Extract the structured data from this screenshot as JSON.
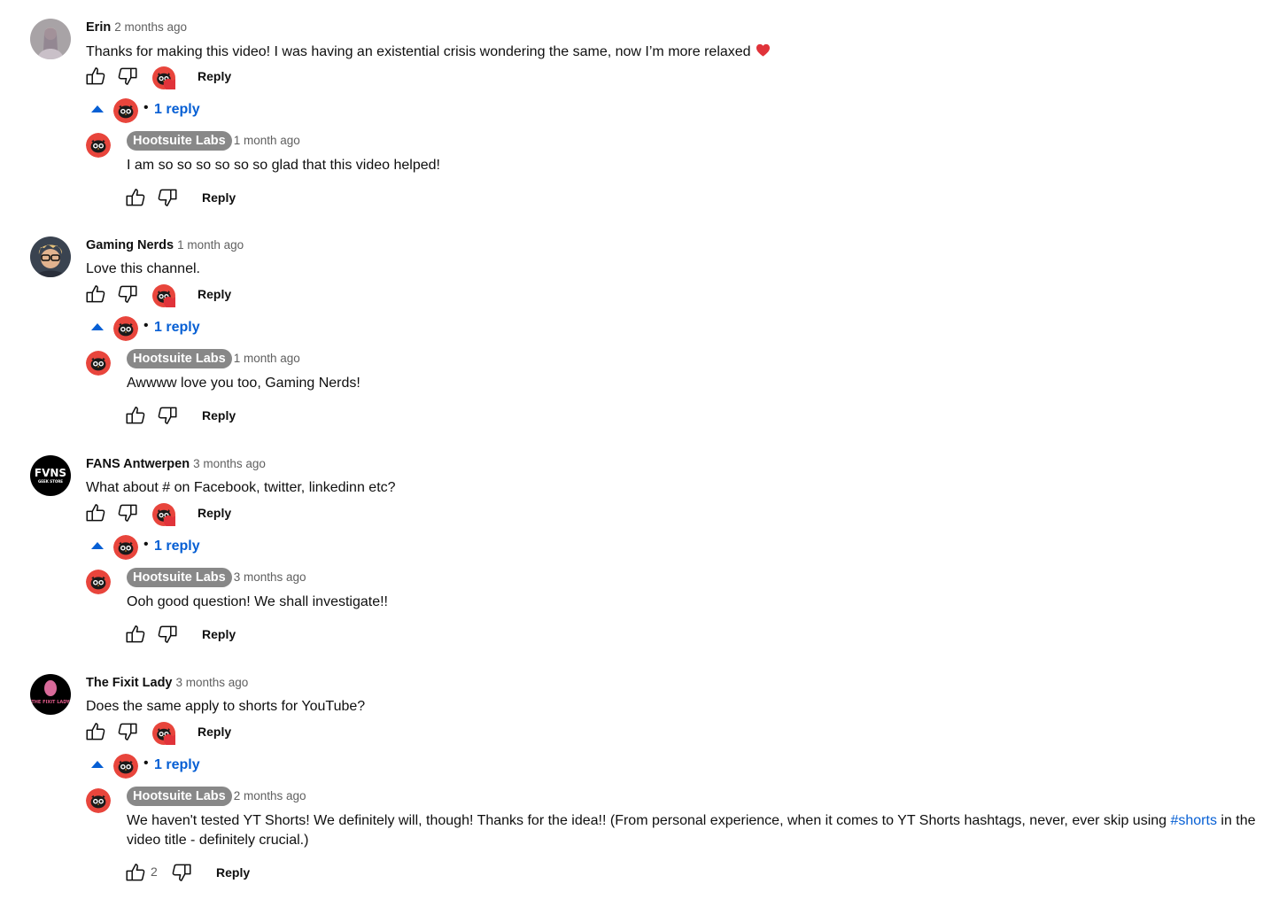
{
  "threads": [
    {
      "author": "Erin",
      "time": "2 months ago",
      "text": "Thanks for making this video! I was having an existential crisis wondering the same, now I’m more relaxed",
      "has_heart_emoji": true,
      "reply_label": "Reply",
      "reply_count": "1 reply",
      "reply": {
        "author": "Hootsuite Labs",
        "time": "1 month ago",
        "text": "I am so so so so so so glad that this video helped!",
        "reply_label": "Reply"
      }
    },
    {
      "author": "Gaming Nerds",
      "time": "1 month ago",
      "text": "Love this channel.",
      "reply_label": "Reply",
      "reply_count": "1 reply",
      "reply": {
        "author": "Hootsuite Labs",
        "time": "1 month ago",
        "text": "Awwww love you too, Gaming Nerds!",
        "reply_label": "Reply"
      }
    },
    {
      "author": "FANS Antwerpen",
      "time": "3 months ago",
      "text": "What about # on Facebook, twitter, linkedinn etc?",
      "reply_label": "Reply",
      "reply_count": "1 reply",
      "avatar_text": "FVNS",
      "avatar_subtext": "GEEK STORE",
      "reply": {
        "author": "Hootsuite Labs",
        "time": "3 months ago",
        "text": "Ooh good question! We shall investigate!!",
        "reply_label": "Reply"
      }
    },
    {
      "author": "The Fixit Lady",
      "time": "3 months ago",
      "text": "Does the same apply to shorts for YouTube?",
      "reply_label": "Reply",
      "reply_count": "1 reply",
      "avatar_text": "THE FIXIT LADY",
      "reply": {
        "author": "Hootsuite Labs",
        "time": "2 months ago",
        "text_before": "We haven't tested YT Shorts! We definitely will, though! Thanks for the idea!! (From personal experience, when it comes to YT Shorts hashtags, never, ever skip using ",
        "hashtag": "#shorts",
        "text_after": " in the video title - definitely crucial.)",
        "like_count": "2",
        "reply_label": "Reply"
      }
    }
  ],
  "colors": {
    "link": "#065fd4",
    "owner_chip": "#888888",
    "hootsuite_red": "#e8453c",
    "heart": "#e0333a"
  },
  "icons": [
    "thumbs-up-icon",
    "thumbs-down-icon",
    "creator-heart-icon",
    "caret-up-icon",
    "heart-emoji-icon"
  ]
}
